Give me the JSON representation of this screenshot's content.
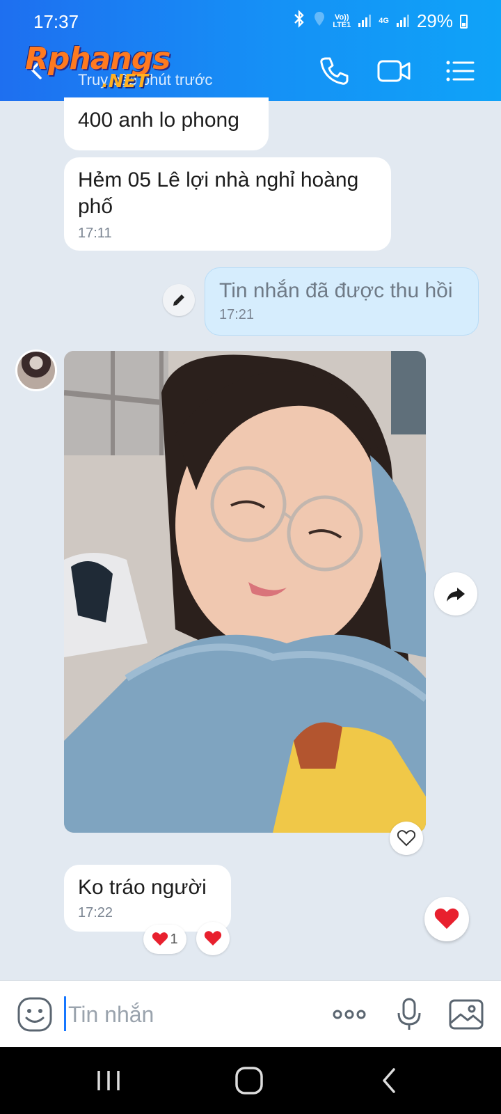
{
  "status_bar": {
    "time": "17:37",
    "volte_line1": "Vo))",
    "volte_line2": "LTE1",
    "network": "4G",
    "battery": "29%"
  },
  "header": {
    "logo_main": "Rphangs",
    "logo_net": ".NET",
    "subtitle": "Truy cập phút trước",
    "icons": [
      "back-icon",
      "phone-icon",
      "video-call-icon",
      "menu-list-icon"
    ]
  },
  "messages": [
    {
      "text": "400 anh lo phong",
      "time": ""
    },
    {
      "text": "Hẻm 05 Lê lợi nhà nghỉ hoàng phố",
      "time": "17:11"
    },
    {
      "text": "Tin nhắn đã được thu hồi",
      "time": "17:21"
    },
    {
      "text": "Ko tráo người",
      "time": "17:22"
    }
  ],
  "reactions": {
    "count": "1"
  },
  "composer": {
    "placeholder": "Tin nhắn",
    "icons": [
      "emoji-icon",
      "more-dots-icon",
      "microphone-icon",
      "image-icon"
    ]
  },
  "colors": {
    "header_gradient_start": "#1e6ff0",
    "header_gradient_end": "#0fa3f8",
    "chat_background": "#e2e9f1",
    "sent_bubble": "#d6edfd",
    "heart_red": "#e8202e"
  }
}
